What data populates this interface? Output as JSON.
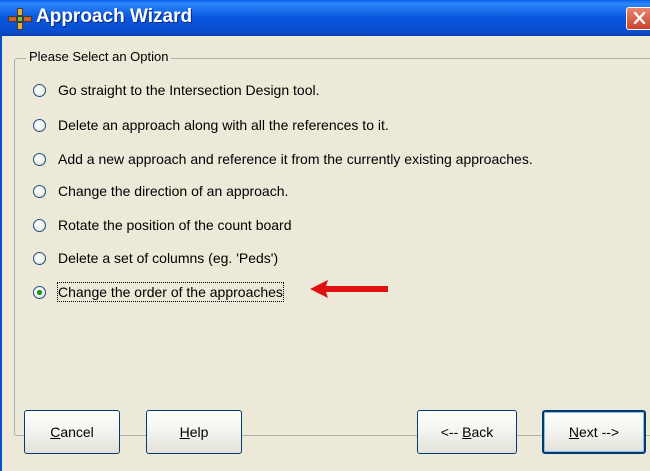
{
  "window": {
    "title": "Approach Wizard"
  },
  "group": {
    "legend": "Please Select an Option"
  },
  "options": [
    {
      "label": "Go straight to the Intersection Design tool.",
      "selected": false
    },
    {
      "label": "Delete an approach along with all the references to it.",
      "selected": false
    },
    {
      "label": "Add a new approach and reference it from the currently existing approaches.",
      "selected": false
    },
    {
      "label": "Change the direction of an approach.",
      "selected": false
    },
    {
      "label": "Rotate the position of the count board",
      "selected": false
    },
    {
      "label": "Delete a set of columns (eg. 'Peds')",
      "selected": false
    },
    {
      "label": "Change the order of the approaches",
      "selected": true
    }
  ],
  "buttons": {
    "cancel": {
      "mnemonic": "C",
      "rest": "ancel"
    },
    "help": {
      "mnemonic": "H",
      "rest": "elp"
    },
    "back": {
      "prefix": "<-- ",
      "mnemonic": "B",
      "rest": "ack"
    },
    "next": {
      "mnemonic": "N",
      "rest": "ext -->"
    }
  },
  "colors": {
    "title_bar": "#0A55DD",
    "background": "#ECE9D8",
    "arrow": "#E01010",
    "radio_selected": "#1B9A1B"
  }
}
